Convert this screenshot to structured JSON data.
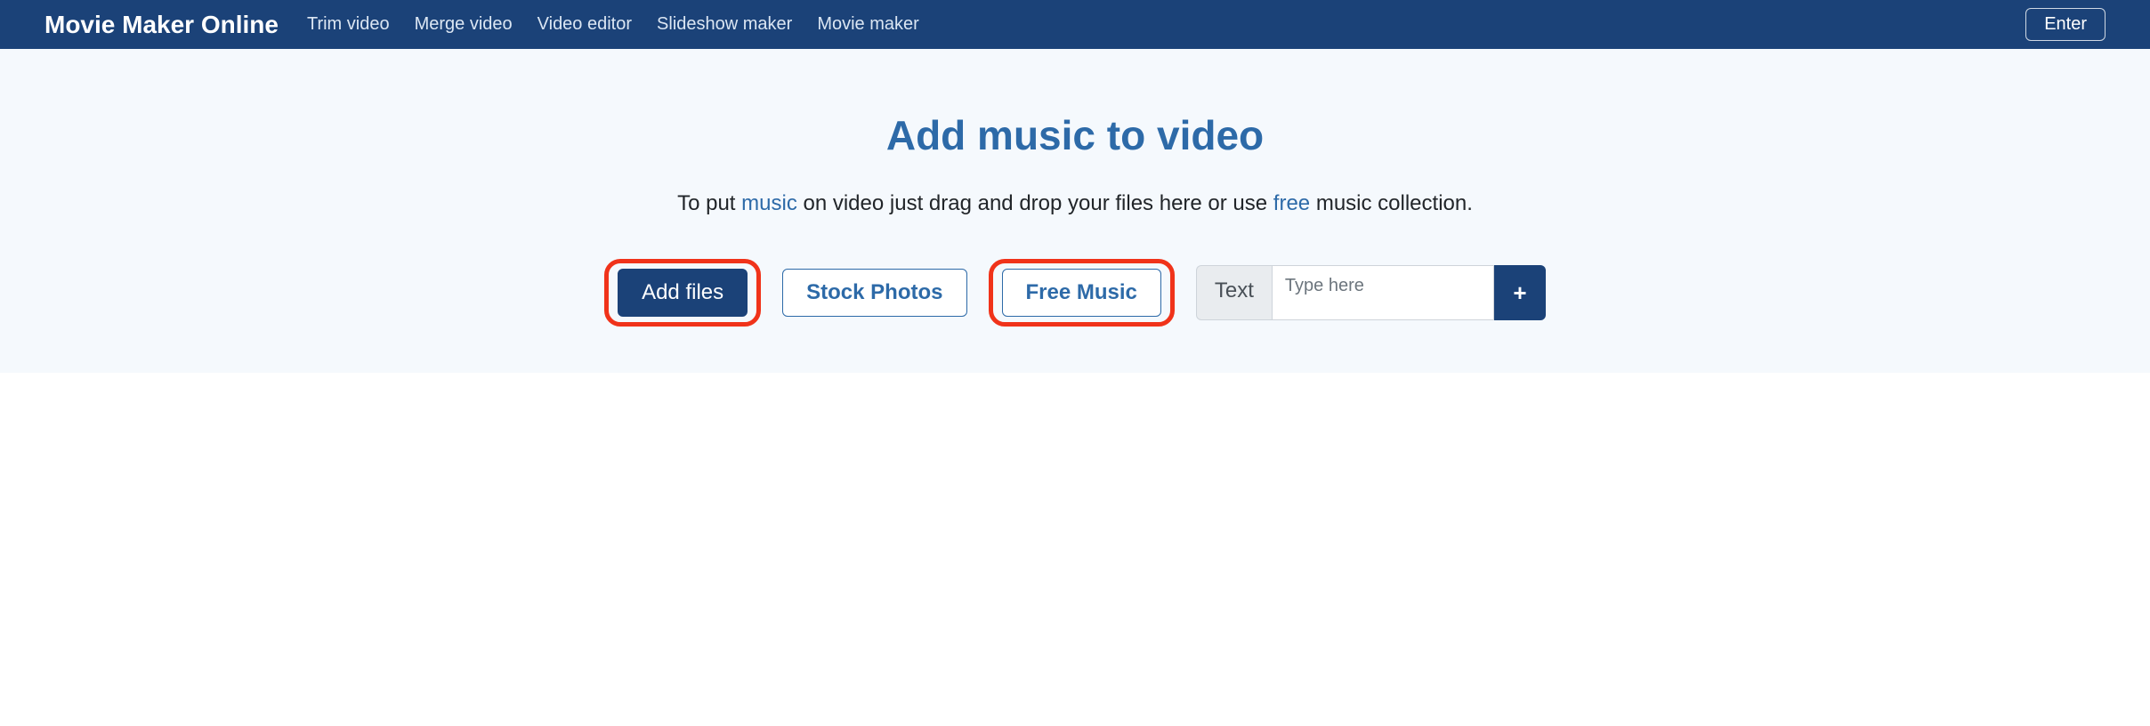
{
  "nav": {
    "brand": "Movie Maker Online",
    "links": {
      "trim": "Trim video",
      "merge": "Merge video",
      "editor": "Video editor",
      "slideshow": "Slideshow maker",
      "movie": "Movie maker"
    },
    "enter": "Enter"
  },
  "hero": {
    "title": "Add music to video",
    "sub_pre": "To put ",
    "sub_link1": "music",
    "sub_mid": " on video just drag and drop your files here or use ",
    "sub_link2": "free",
    "sub_post": " music collection."
  },
  "actions": {
    "add_files": "Add files",
    "stock_photos": "Stock Photos",
    "free_music": "Free Music",
    "text_label": "Text",
    "text_placeholder": "Type here",
    "plus": "+"
  }
}
